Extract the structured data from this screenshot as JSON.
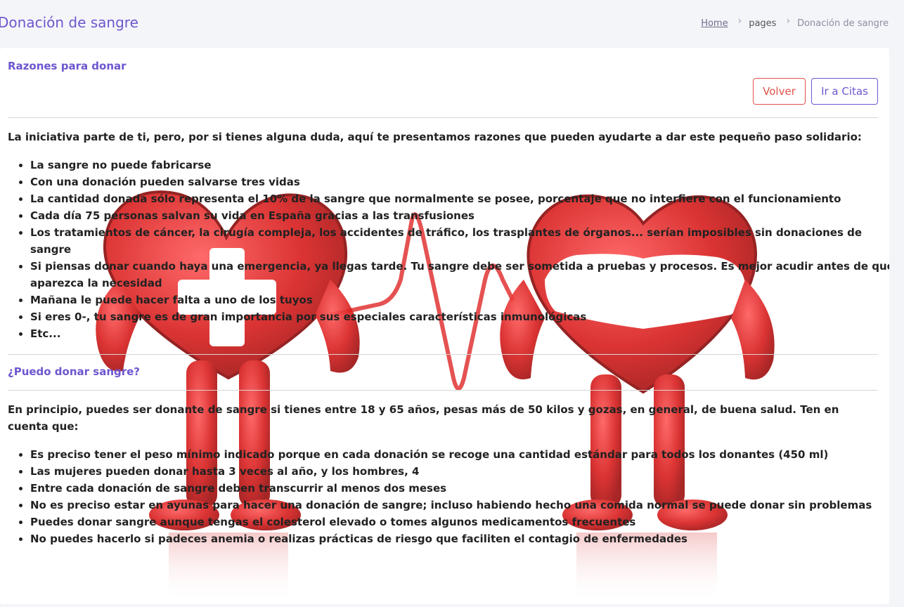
{
  "header": {
    "title": "Donación de sangre",
    "breadcrumb": {
      "home": "Home",
      "pages": "pages",
      "current": "Donación de sangre"
    }
  },
  "section1": {
    "title": "Razones para donar",
    "back_label": "Volver",
    "appointments_label": "Ir a Citas",
    "intro": "La iniciativa parte de ti, pero, por si tienes alguna duda, aquí te presentamos razones que pueden ayudarte a dar este pequeño paso solidario:",
    "items": [
      "La sangre no puede fabricarse",
      "Con una donación pueden salvarse tres vidas",
      "La cantidad donada sólo representa el 10% de la sangre que normalmente se posee, porcentaje que no interfiere con el funcionamiento",
      "Cada día 75 personas salvan su vida en España gracias a las transfusiones",
      "Los tratamientos de cáncer, la cirugía compleja, los accidentes de tráfico, los trasplantes de órganos... serían imposibles sin donaciones de sangre",
      "Si piensas donar cuando haya una emergencia, ya llegas tarde. Tu sangre debe ser sometida a pruebas y procesos. Es mejor acudir antes de que aparezca la necesidad",
      "Mañana le puede hacer falta a uno de los tuyos",
      "Si eres 0-, tu sangre es de gran importancia por sus especiales características inmunológicas",
      "Etc..."
    ]
  },
  "section2": {
    "title": "¿Puedo donar sangre?",
    "intro": "En principio, puedes ser donante de sangre si tienes entre 18 y 65 años, pesas más de 50 kilos y gozas, en general, de buena salud. Ten en cuenta que:",
    "items": [
      "Es preciso tener el peso mínimo indicado porque en cada donación se recoge una cantidad estándar para todos los donantes (450 ml)",
      "Las mujeres pueden donar hasta 3 veces al año, y los hombres, 4",
      "Entre cada donación de sangre deben transcurrir al menos dos meses",
      "No es preciso estar en ayunas para hacer una donación de sangre; incluso habiendo hecho una comida normal se puede donar sin problemas",
      "Puedes donar sangre aunque tengas el colesterol elevado o tomes algunos medicamentos frecuentes",
      "No puedes hacerlo si padeces anemia o realizas prácticas de riesgo que faciliten el contagio de enfermedades"
    ]
  },
  "colors": {
    "accent": "#6e56cf",
    "danger": "#e0524a",
    "heart_red": "#d81e1e"
  },
  "icons": {
    "breadcrumb_separator": "chevron-right-icon",
    "illustration": "blood-drop-hearts-illustration"
  }
}
